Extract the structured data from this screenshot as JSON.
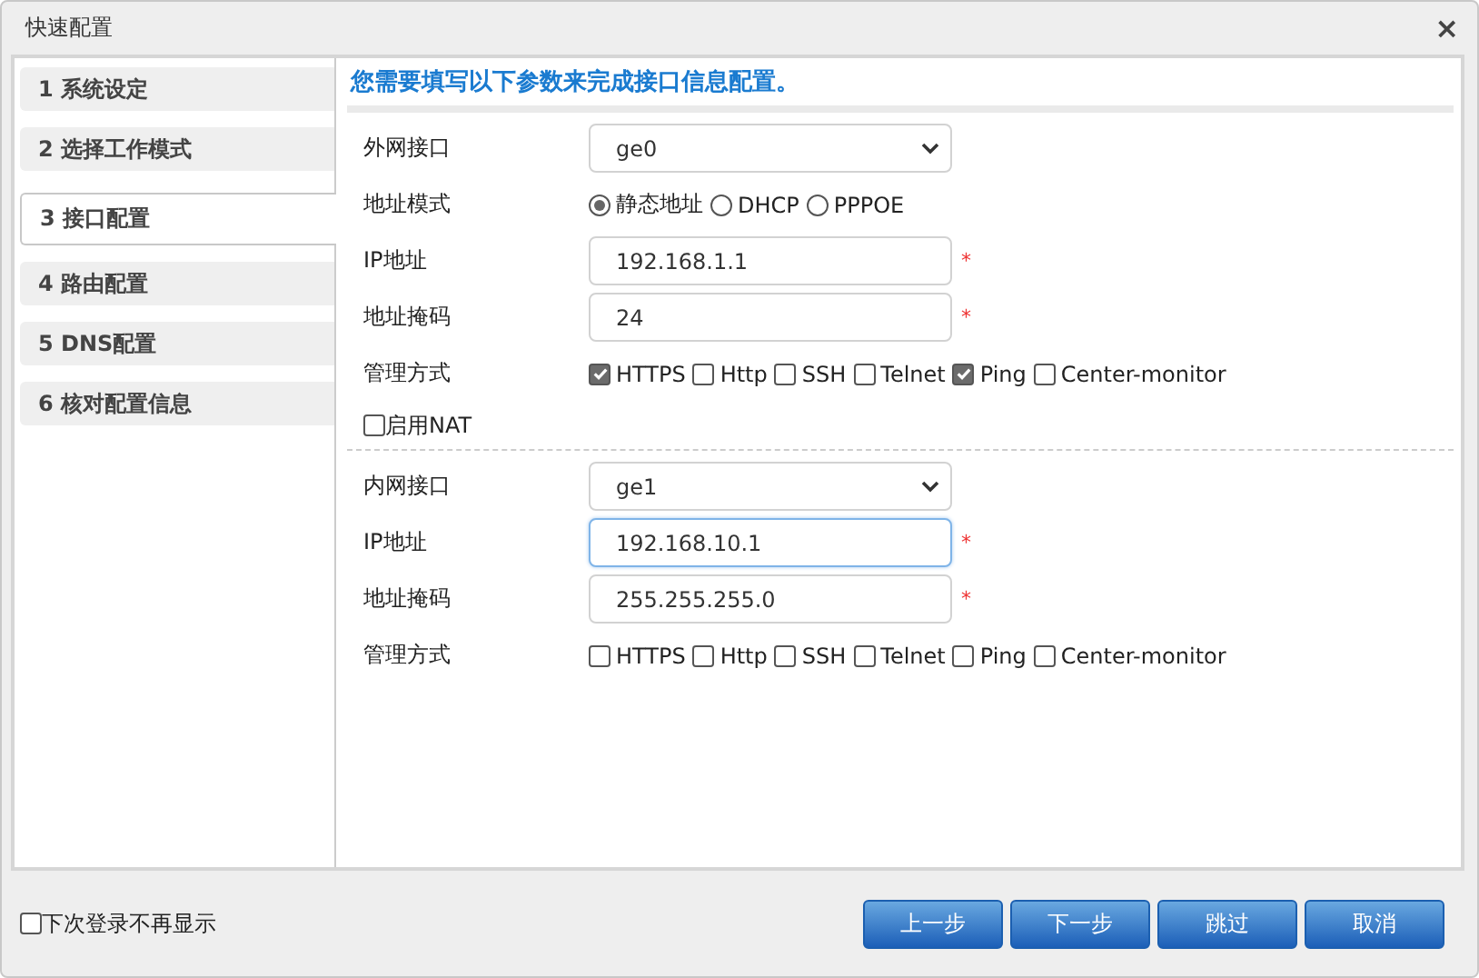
{
  "window": {
    "title": "快速配置",
    "close": "×"
  },
  "steps": [
    {
      "label": "1 系统设定",
      "selected": false
    },
    {
      "label": "2 选择工作模式",
      "selected": false
    },
    {
      "label": "3 接口配置",
      "selected": true
    },
    {
      "label": "4 路由配置",
      "selected": false
    },
    {
      "label": "5 DNS配置",
      "selected": false
    },
    {
      "label": "6 核对配置信息",
      "selected": false
    }
  ],
  "heading": "您需要填写以下参数来完成接口信息配置。",
  "sections": [
    {
      "rows": [
        {
          "kind": "select",
          "label": "外网接口",
          "value": "ge0"
        },
        {
          "kind": "radio",
          "label": "地址模式",
          "options": [
            {
              "label": "静态地址",
              "selected": true
            },
            {
              "label": "DHCP",
              "selected": false
            },
            {
              "label": "PPPOE",
              "selected": false
            }
          ]
        },
        {
          "kind": "input",
          "label": "IP地址",
          "value": "192.168.1.1",
          "required": "*",
          "focused": false
        },
        {
          "kind": "input",
          "label": "地址掩码",
          "value": "24",
          "required": "*",
          "focused": false
        },
        {
          "kind": "checks",
          "label": "管理方式",
          "options": [
            {
              "label": "HTTPS",
              "checked": true
            },
            {
              "label": "Http",
              "checked": false
            },
            {
              "label": "SSH",
              "checked": false
            },
            {
              "label": "Telnet",
              "checked": false
            },
            {
              "label": "Ping",
              "checked": true
            },
            {
              "label": "Center-monitor",
              "checked": false
            }
          ]
        },
        {
          "kind": "toggle",
          "label": "启用NAT",
          "checked": false
        }
      ]
    },
    {
      "rows": [
        {
          "kind": "select",
          "label": "内网接口",
          "value": "ge1"
        },
        {
          "kind": "input",
          "label": "IP地址",
          "value": "192.168.10.1",
          "required": "*",
          "focused": true
        },
        {
          "kind": "input",
          "label": "地址掩码",
          "value": "255.255.255.0",
          "required": "*",
          "focused": false
        },
        {
          "kind": "checks",
          "label": "管理方式",
          "options": [
            {
              "label": "HTTPS",
              "checked": false
            },
            {
              "label": "Http",
              "checked": false
            },
            {
              "label": "SSH",
              "checked": false
            },
            {
              "label": "Telnet",
              "checked": false
            },
            {
              "label": "Ping",
              "checked": false
            },
            {
              "label": "Center-monitor",
              "checked": false
            }
          ]
        }
      ]
    }
  ],
  "footer": {
    "dont_show": {
      "label": "下次登录不再显示",
      "checked": false
    },
    "buttons": [
      "上一步",
      "下一步",
      "跳过",
      "取消"
    ]
  }
}
